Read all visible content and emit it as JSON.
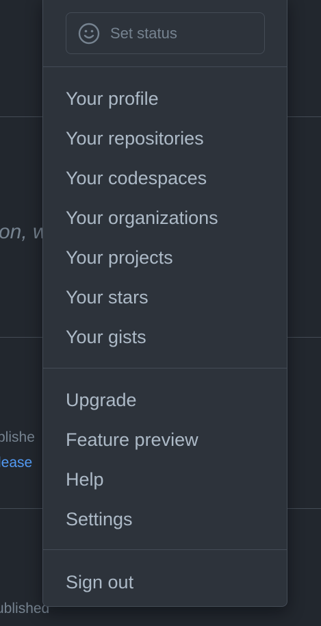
{
  "background": {
    "fragment_italic": "on, w",
    "fragment_published_1": "blishe",
    "fragment_release": "lease",
    "fragment_published_2": "ublished"
  },
  "menu": {
    "set_status": {
      "label": "Set status",
      "icon": "smiley-icon"
    },
    "group1": [
      "Your profile",
      "Your repositories",
      "Your codespaces",
      "Your organizations",
      "Your projects",
      "Your stars",
      "Your gists"
    ],
    "group2": [
      "Upgrade",
      "Feature preview",
      "Help",
      "Settings"
    ],
    "group3": [
      "Sign out"
    ]
  },
  "colors": {
    "page_bg": "#22272e",
    "menu_bg": "#2d333b",
    "border": "#444c56",
    "text": "#adbac7",
    "muted": "#768390",
    "link": "#539bf5"
  }
}
